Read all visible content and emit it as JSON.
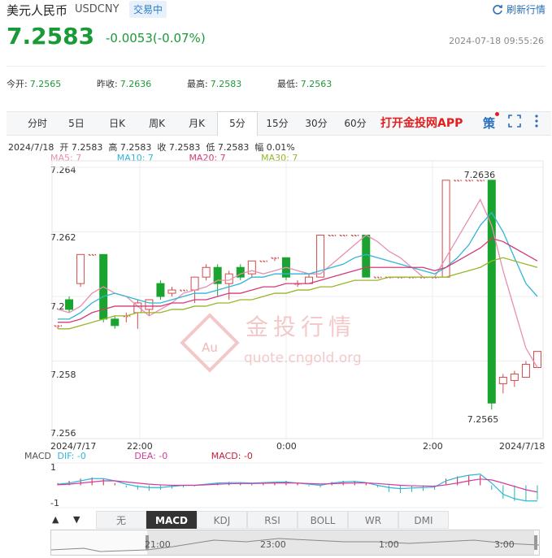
{
  "header": {
    "name": "美元人民币",
    "code": "USDCNY",
    "status": "交易中",
    "refresh_label": "刷新行情",
    "price": "7.2583",
    "change": "-0.0053(-0.07%)",
    "timestamp": "2024-07-18 09:55:26"
  },
  "stats": [
    {
      "label": "今开:",
      "value": "7.2565"
    },
    {
      "label": "昨收:",
      "value": "7.2636"
    },
    {
      "label": "最高:",
      "value": "7.2583"
    },
    {
      "label": "最低:",
      "value": "7.2563"
    }
  ],
  "tabs": [
    {
      "label": "分时"
    },
    {
      "label": "5日"
    },
    {
      "label": "日K"
    },
    {
      "label": "周K"
    },
    {
      "label": "月K"
    },
    {
      "label": "5分",
      "active": true
    },
    {
      "label": "15分"
    },
    {
      "label": "30分"
    },
    {
      "label": "60分"
    }
  ],
  "app_link": "打开金投网APP",
  "strategy_icon_label": "策",
  "ohlc_line": "2024/7/18  开 7.2583  高 7.2583  收 7.2583  低 7.2583  幅 0.01%",
  "ma": {
    "ma5": "MA5: 7",
    "ma10": "MA10: 7",
    "ma20": "MA20: 7",
    "ma30": "MA30: 7"
  },
  "watermark": {
    "cn": "金投行情",
    "url": "quote.cngold.org",
    "badge": "Au"
  },
  "macd": {
    "label": "MACD",
    "dif": "DIF: -0",
    "dea": "DEA: -0",
    "macd": "MACD: -0",
    "y_top": "1",
    "y_bottom": "-1"
  },
  "indicator_tabs": [
    {
      "label": "无"
    },
    {
      "label": "MACD",
      "active": true
    },
    {
      "label": "KDJ"
    },
    {
      "label": "RSI"
    },
    {
      "label": "BOLL"
    },
    {
      "label": "WR"
    },
    {
      "label": "DMI"
    }
  ],
  "arrow_up": "▲",
  "arrow_down": "▼",
  "navigator_ticks": [
    "21:00",
    "23:00",
    "1:00",
    "3:00"
  ],
  "chart_data": {
    "type": "candlestick",
    "y_ticks": [
      "7.264",
      "7.262",
      "7.26",
      "7.258",
      "7.256"
    ],
    "ylim": [
      7.2556,
      7.2642
    ],
    "x_ticks": [
      "2024/7/17",
      "22:00",
      "0:00",
      "2:00",
      "2024/7/18"
    ],
    "annotations": {
      "high": "7.2636",
      "low": "7.2565"
    },
    "candles": [
      {
        "o": 7.2591,
        "c": 7.2591,
        "h": 7.2591,
        "l": 7.259
      },
      {
        "o": 7.2599,
        "c": 7.2596,
        "h": 7.26,
        "l": 7.2595
      },
      {
        "o": 7.2604,
        "c": 7.2613,
        "h": 7.2613,
        "l": 7.2603
      },
      {
        "o": 7.2613,
        "c": 7.2613,
        "h": 7.2613,
        "l": 7.2613
      },
      {
        "o": 7.2613,
        "c": 7.2593,
        "h": 7.2613,
        "l": 7.2592
      },
      {
        "o": 7.2593,
        "c": 7.2591,
        "h": 7.2594,
        "l": 7.259
      },
      {
        "o": 7.2594,
        "c": 7.2594,
        "h": 7.2595,
        "l": 7.2592
      },
      {
        "o": 7.2595,
        "c": 7.2598,
        "h": 7.2599,
        "l": 7.259
      },
      {
        "o": 7.2596,
        "c": 7.2599,
        "h": 7.2599,
        "l": 7.2594
      },
      {
        "o": 7.2604,
        "c": 7.26,
        "h": 7.2605,
        "l": 7.2599
      },
      {
        "o": 7.2601,
        "c": 7.2602,
        "h": 7.2603,
        "l": 7.26
      },
      {
        "o": 7.2602,
        "c": 7.2602,
        "h": 7.2602,
        "l": 7.2602
      },
      {
        "o": 7.2602,
        "c": 7.2606,
        "h": 7.2606,
        "l": 7.2598
      },
      {
        "o": 7.2606,
        "c": 7.2609,
        "h": 7.261,
        "l": 7.2605
      },
      {
        "o": 7.2609,
        "c": 7.2604,
        "h": 7.261,
        "l": 7.26
      },
      {
        "o": 7.2604,
        "c": 7.2607,
        "h": 7.2608,
        "l": 7.2599
      },
      {
        "o": 7.2609,
        "c": 7.2606,
        "h": 7.261,
        "l": 7.2605
      },
      {
        "o": 7.2607,
        "c": 7.2611,
        "h": 7.2611,
        "l": 7.2606
      },
      {
        "o": 7.2611,
        "c": 7.2611,
        "h": 7.2611,
        "l": 7.2611
      },
      {
        "o": 7.2612,
        "c": 7.2612,
        "h": 7.2612,
        "l": 7.2611
      },
      {
        "o": 7.2612,
        "c": 7.2606,
        "h": 7.2612,
        "l": 7.2605
      },
      {
        "o": 7.2604,
        "c": 7.2604,
        "h": 7.2605,
        "l": 7.2603
      },
      {
        "o": 7.2604,
        "c": 7.2606,
        "h": 7.2607,
        "l": 7.2604
      },
      {
        "o": 7.2606,
        "c": 7.2619,
        "h": 7.2619,
        "l": 7.2606
      },
      {
        "o": 7.2619,
        "c": 7.2619,
        "h": 7.2619,
        "l": 7.2619
      },
      {
        "o": 7.2619,
        "c": 7.2619,
        "h": 7.2619,
        "l": 7.2619
      },
      {
        "o": 7.2619,
        "c": 7.2619,
        "h": 7.2619,
        "l": 7.2619
      },
      {
        "o": 7.2619,
        "c": 7.2606,
        "h": 7.2619,
        "l": 7.2606
      },
      {
        "o": 7.2606,
        "c": 7.2606,
        "h": 7.2606,
        "l": 7.2606
      },
      {
        "o": 7.2606,
        "c": 7.2606,
        "h": 7.2606,
        "l": 7.2606
      },
      {
        "o": 7.2606,
        "c": 7.2606,
        "h": 7.2606,
        "l": 7.2606
      },
      {
        "o": 7.2606,
        "c": 7.2606,
        "h": 7.2606,
        "l": 7.2606
      },
      {
        "o": 7.2606,
        "c": 7.2606,
        "h": 7.2606,
        "l": 7.2606
      },
      {
        "o": 7.2606,
        "c": 7.2606,
        "h": 7.2606,
        "l": 7.2606
      },
      {
        "o": 7.2606,
        "c": 7.2636,
        "h": 7.2636,
        "l": 7.2606
      },
      {
        "o": 7.2636,
        "c": 7.2636,
        "h": 7.2636,
        "l": 7.2636
      },
      {
        "o": 7.2636,
        "c": 7.2636,
        "h": 7.2636,
        "l": 7.2636
      },
      {
        "o": 7.2636,
        "c": 7.2636,
        "h": 7.2636,
        "l": 7.2636
      },
      {
        "o": 7.2636,
        "c": 7.2567,
        "h": 7.2636,
        "l": 7.2565
      },
      {
        "o": 7.2573,
        "c": 7.2575,
        "h": 7.2576,
        "l": 7.257
      },
      {
        "o": 7.2574,
        "c": 7.2576,
        "h": 7.2577,
        "l": 7.2572
      },
      {
        "o": 7.2575,
        "c": 7.2579,
        "h": 7.258,
        "l": 7.2575
      },
      {
        "o": 7.2578,
        "c": 7.2583,
        "h": 7.2583,
        "l": 7.2578
      }
    ],
    "series": [
      {
        "name": "MA5",
        "color": "#e88fb1",
        "values": [
          7.2596,
          7.2595,
          7.2597,
          7.2601,
          7.2603,
          7.2601,
          7.26,
          7.2597,
          7.2594,
          7.2596,
          7.2598,
          7.2601,
          7.2602,
          7.2603,
          7.2605,
          7.2605,
          7.2607,
          7.2608,
          7.2607,
          7.2608,
          7.2609,
          7.2608,
          7.2607,
          7.2607,
          7.261,
          7.2613,
          7.2616,
          7.2619,
          7.2617,
          7.2614,
          7.2612,
          7.2609,
          7.2606,
          7.2606,
          7.2612,
          7.2618,
          7.2624,
          7.263,
          7.2622,
          7.2608,
          7.2596,
          7.2584,
          7.2578
        ]
      },
      {
        "name": "MA10",
        "color": "#2fb6d8",
        "values": [
          7.2593,
          7.2593,
          7.2595,
          7.2598,
          7.26,
          7.2601,
          7.26,
          7.2599,
          7.2598,
          7.2598,
          7.2599,
          7.26,
          7.2601,
          7.2601,
          7.2602,
          7.2603,
          7.2604,
          7.2606,
          7.2606,
          7.2607,
          7.2607,
          7.2607,
          7.2607,
          7.2608,
          7.2609,
          7.261,
          7.2612,
          7.2613,
          7.2612,
          7.2611,
          7.261,
          7.2609,
          7.2608,
          7.2607,
          7.2609,
          7.2612,
          7.2616,
          7.2622,
          7.2626,
          7.262,
          7.2612,
          7.2604,
          7.26
        ]
      },
      {
        "name": "MA20",
        "color": "#d43a7a",
        "values": [
          7.2592,
          7.2592,
          7.2593,
          7.2595,
          7.2596,
          7.2597,
          7.2597,
          7.2597,
          7.2597,
          7.2597,
          7.2598,
          7.2598,
          7.2599,
          7.2599,
          7.26,
          7.2601,
          7.2601,
          7.2602,
          7.2603,
          7.2603,
          7.2604,
          7.2604,
          7.2604,
          7.2605,
          7.2606,
          7.2607,
          7.2608,
          7.2609,
          7.2609,
          7.2609,
          7.2609,
          7.2609,
          7.2609,
          7.2608,
          7.2609,
          7.2611,
          7.2613,
          7.2615,
          7.2618,
          7.2617,
          7.2615,
          7.2613,
          7.2611
        ]
      },
      {
        "name": "MA30",
        "color": "#97b62a",
        "values": [
          7.259,
          7.259,
          7.2591,
          7.2592,
          7.2593,
          7.2594,
          7.2594,
          7.2595,
          7.2595,
          7.2595,
          7.2596,
          7.2596,
          7.2597,
          7.2597,
          7.2598,
          7.2598,
          7.2599,
          7.2599,
          7.26,
          7.2601,
          7.2601,
          7.2602,
          7.2602,
          7.2603,
          7.2603,
          7.2604,
          7.2605,
          7.2605,
          7.2605,
          7.2606,
          7.2606,
          7.2606,
          7.2606,
          7.2606,
          7.2606,
          7.2607,
          7.2608,
          7.2609,
          7.2611,
          7.2612,
          7.2611,
          7.261,
          7.2609
        ]
      }
    ],
    "macd_hist": [
      0.1,
      0.2,
      0.3,
      0.35,
      0.3,
      0.1,
      -0.1,
      -0.2,
      -0.25,
      -0.2,
      -0.15,
      -0.1,
      -0.05,
      0.05,
      0.1,
      0.15,
      0.1,
      0.05,
      0.1,
      0.15,
      0.2,
      0.1,
      -0.05,
      -0.1,
      0.15,
      0.2,
      0.2,
      0.1,
      -0.1,
      -0.3,
      -0.35,
      -0.3,
      -0.25,
      -0.2,
      0.3,
      0.4,
      0.45,
      0.45,
      -0.2,
      -0.6,
      -0.7,
      -0.7,
      -0.65
    ],
    "macd_dif": [
      0.05,
      0.1,
      0.2,
      0.3,
      0.3,
      0.2,
      0.05,
      -0.05,
      -0.1,
      -0.1,
      -0.05,
      0.0,
      0.0,
      0.05,
      0.1,
      0.12,
      0.12,
      0.1,
      0.12,
      0.14,
      0.15,
      0.1,
      0.05,
      0.0,
      0.1,
      0.15,
      0.18,
      0.12,
      0.0,
      -0.1,
      -0.15,
      -0.12,
      -0.1,
      -0.08,
      0.2,
      0.35,
      0.45,
      0.5,
      0.1,
      -0.4,
      -0.6,
      -0.7,
      -0.7
    ],
    "macd_dea": [
      0.02,
      0.05,
      0.1,
      0.15,
      0.2,
      0.2,
      0.15,
      0.1,
      0.05,
      0.02,
      0.0,
      0.0,
      0.0,
      0.02,
      0.05,
      0.07,
      0.08,
      0.08,
      0.09,
      0.1,
      0.11,
      0.1,
      0.08,
      0.06,
      0.07,
      0.09,
      0.11,
      0.11,
      0.08,
      0.04,
      0.0,
      -0.02,
      -0.03,
      -0.04,
      0.02,
      0.1,
      0.2,
      0.28,
      0.24,
      0.1,
      -0.05,
      -0.2,
      -0.3
    ]
  }
}
